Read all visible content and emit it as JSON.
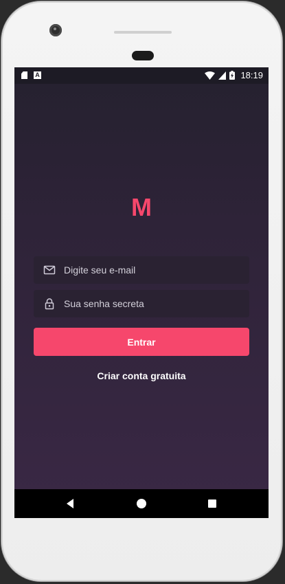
{
  "status_bar": {
    "time": "18:19",
    "left_icons": [
      "sd-card-icon",
      "a-notification-icon"
    ],
    "right_icons": [
      "wifi-icon",
      "signal-icon",
      "battery-charging-icon"
    ],
    "a_glyph": "A"
  },
  "app": {
    "logo_text": "M",
    "accent_color": "#f6476c"
  },
  "form": {
    "email_placeholder": "Digite seu e-mail",
    "email_value": "",
    "password_placeholder": "Sua senha secreta",
    "password_value": "",
    "submit_label": "Entrar",
    "signup_label": "Criar conta gratuita"
  },
  "nav_bar": {
    "buttons": [
      "back-icon",
      "home-icon",
      "recent-apps-icon"
    ]
  }
}
